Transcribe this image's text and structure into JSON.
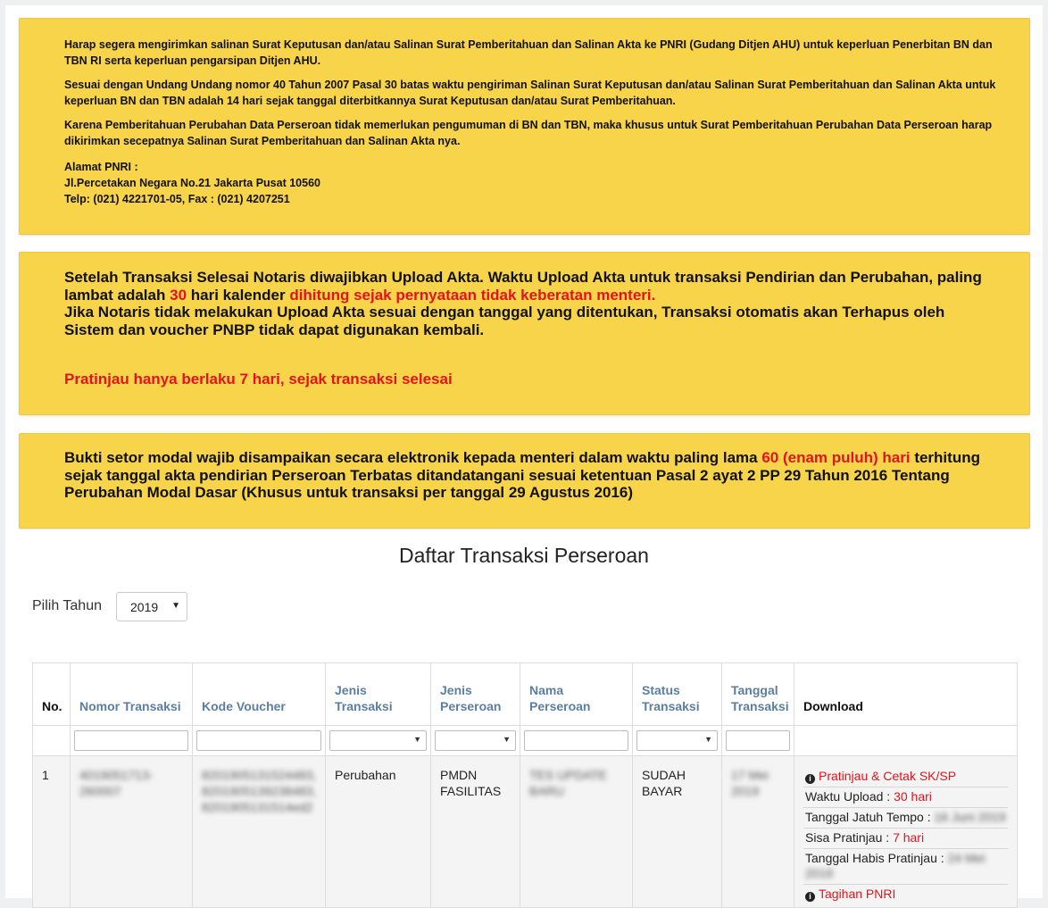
{
  "notices": {
    "pnri": {
      "p1": "Harap segera mengirimkan salinan Surat Keputusan dan/atau Salinan Surat Pemberitahuan dan Salinan Akta ke PNRI (Gudang Ditjen AHU) untuk keperluan Penerbitan BN dan TBN RI serta keperluan pengarsipan Ditjen AHU.",
      "p2": "Sesuai dengan Undang Undang nomor 40 Tahun 2007 Pasal 30 batas waktu pengiriman Salinan Surat Keputusan dan/atau Salinan Surat Pemberitahuan dan Salinan Akta untuk keperluan BN dan TBN adalah 14 hari sejak tanggal diterbitkannya Surat Keputusan dan/atau Surat Pemberitahuan.",
      "p3": "Karena Pemberitahuan Perubahan Data Perseroan tidak memerlukan pengumuman di BN dan TBN, maka khusus untuk Surat Pemberitahuan Perubahan Data Perseroan harap dikirimkan secepatnya Salinan Surat Pemberitahuan dan Salinan Akta nya.",
      "address_label": "Alamat PNRI :",
      "address_line": "Jl.Percetakan Negara No.21 Jakarta Pusat 10560",
      "phone_line": "Telp: (021) 4221701-05, Fax : (021) 4207251"
    },
    "upload": {
      "text1": "Setelah Transaksi Selesai Notaris diwajibkan Upload Akta. Waktu Upload Akta untuk transaksi Pendirian dan Perubahan, paling lambat adalah ",
      "days": "30",
      "text2": " hari kalender ",
      "text3": "dihitung sejak pernyataan tidak keberatan menteri.",
      "text4": "Jika Notaris tidak melakukan Upload Akta sesuai dengan tanggal yang ditentukan, Transaksi otomatis akan Terhapus oleh Sistem dan voucher PNBP tidak dapat digunakan kembali.",
      "preview": "Pratinjau hanya berlaku 7 hari, sejak transaksi selesai"
    },
    "capital": {
      "text1": "Bukti setor modal wajib disampaikan secara elektronik kepada menteri dalam waktu paling lama ",
      "days": "60 (enam puluh) hari",
      "text2": " terhitung sejak tanggal akta pendirian Perseroan Terbatas ditandatangani sesuai ketentuan Pasal 2 ayat 2 PP 29 Tahun 2016 Tentang Perubahan Modal Dasar (Khusus untuk transaksi per tanggal 29 Agustus 2016)"
    }
  },
  "title": "Daftar Transaksi Perseroan",
  "year_filter": {
    "label": "Pilih Tahun",
    "selected": "2019"
  },
  "table": {
    "headers": {
      "no": "No.",
      "nomor": "Nomor Transaksi",
      "kode": "Kode Voucher",
      "jenis": "Jenis Transaksi",
      "jenis_perseroan_1": "Jenis",
      "jenis_perseroan_2": "Perseroan",
      "nama": "Nama Perseroan",
      "status_1": "Status",
      "status_2": "Transaksi",
      "tanggal_1": "Tanggal",
      "tanggal_2": "Transaksi",
      "download": "Download"
    },
    "rows": [
      {
        "no": "1",
        "nomor": "4019051713-260007",
        "kode_1": "8201905131524483,",
        "kode_2": "8201905139238483,",
        "kode_3": "8201905131514ed2",
        "jenis": "Perubahan",
        "jenis_perseroan_1": "PMDN",
        "jenis_perseroan_2": "FASILITAS",
        "nama_1": "TES UPDATE",
        "nama_2": "BARU",
        "status_1": "SUDAH",
        "status_2": "BAYAR",
        "tanggal_1": "17 Mei",
        "tanggal_2": "2019",
        "download": {
          "preview_link": "Pratinjau & Cetak SK/SP",
          "upload_label": "Waktu Upload : ",
          "upload_value": "30 hari",
          "due_label": "Tanggal Jatuh Tempo : ",
          "due_value": "16 Juni 2019",
          "remaining_label": "Sisa Pratinjau : ",
          "remaining_value": "7 hari",
          "expire_label": "Tanggal Habis Pratinjau : ",
          "expire_value": "24 Mei 2019",
          "invoice_link": "Tagihan PNRI"
        }
      }
    ]
  },
  "colors": {
    "notice_bg": "#f8d44a",
    "alert_red": "#e3131b",
    "status_green": "#2e8b2e",
    "header_blue": "#5b7ea1"
  }
}
